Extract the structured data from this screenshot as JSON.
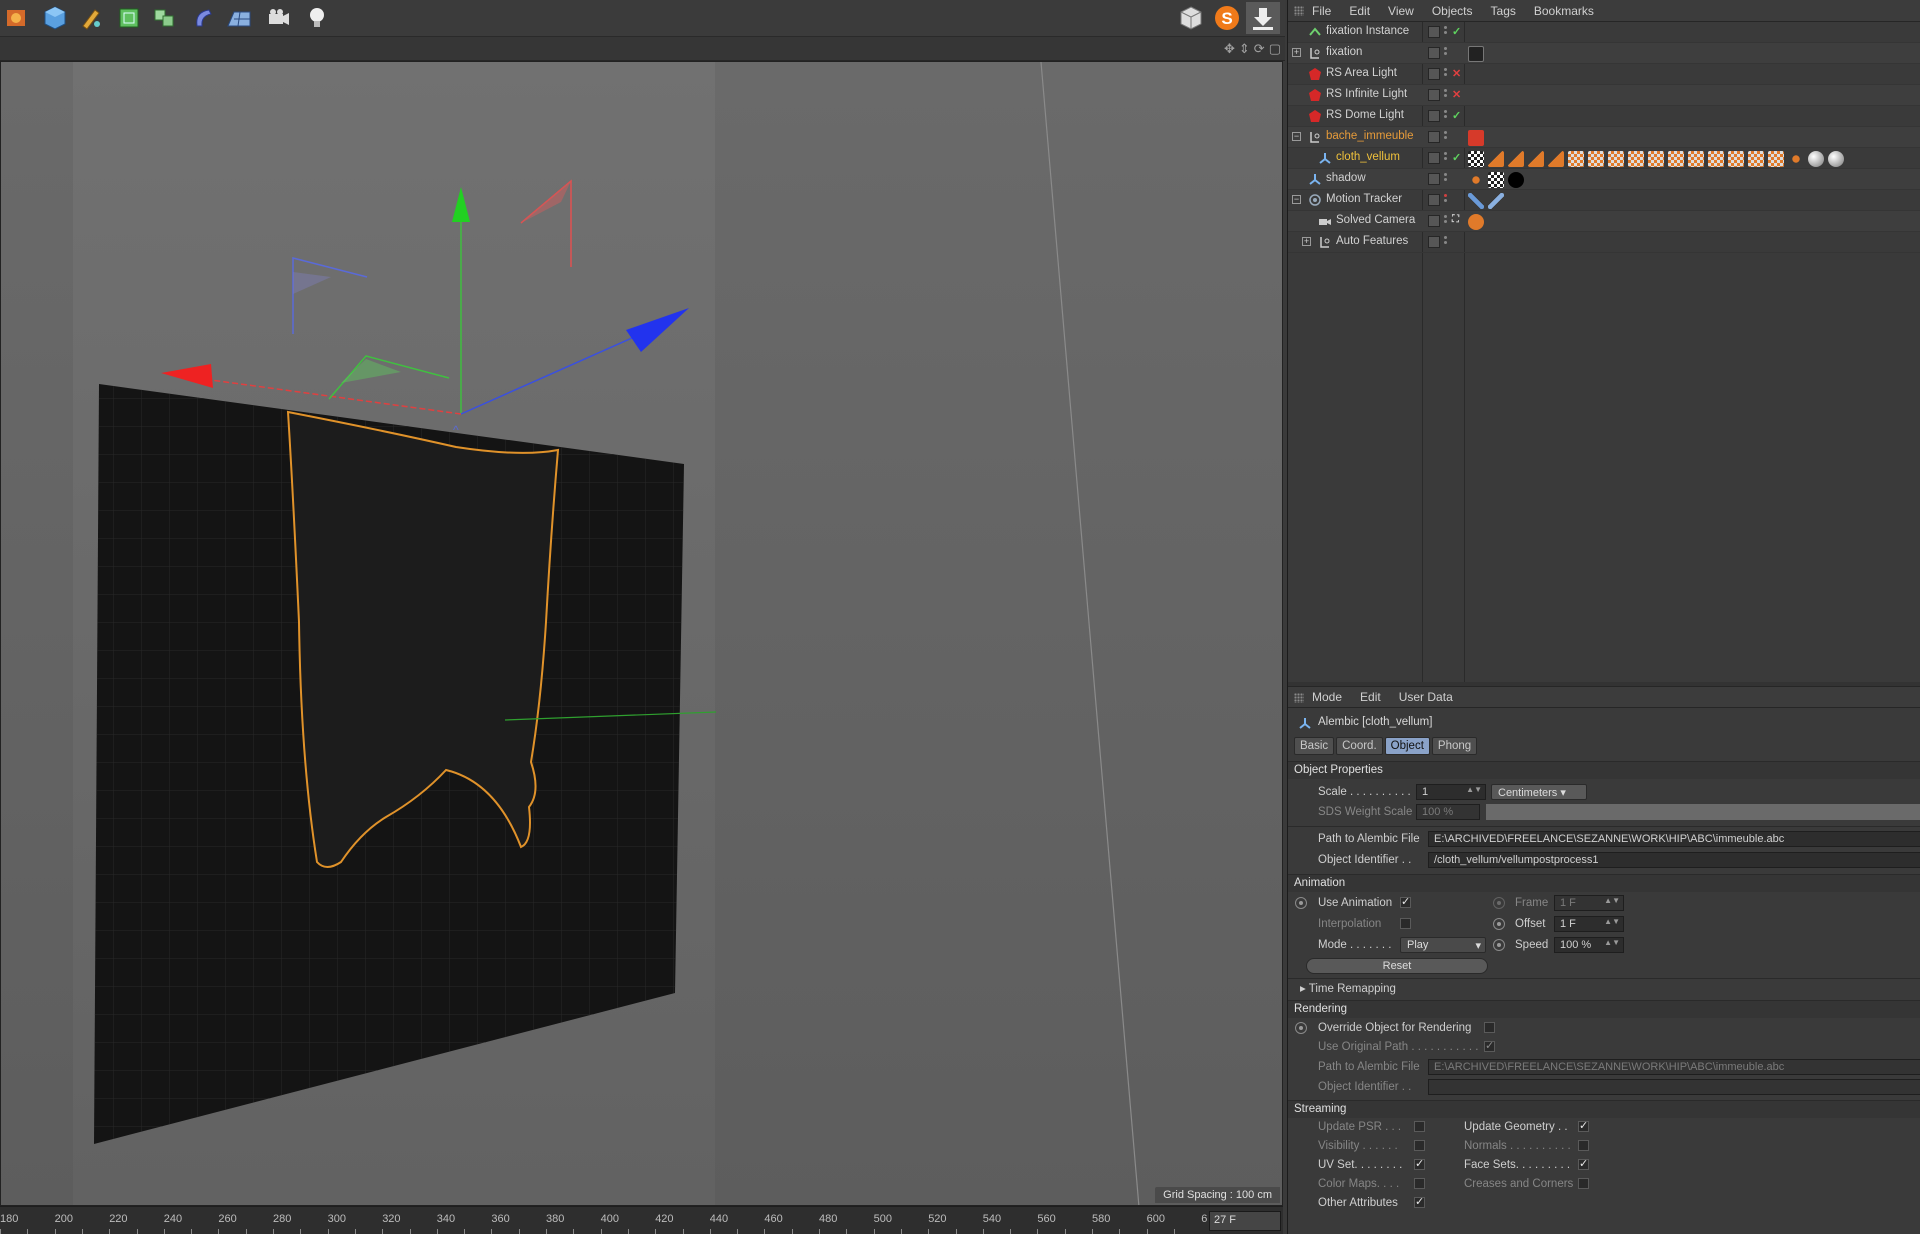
{
  "toolbar": {
    "icons": [
      "render-icon",
      "cube-icon",
      "pen-icon",
      "subdivision-icon",
      "array-icon",
      "deformer-icon",
      "floor-icon",
      "camera-icon",
      "light-icon"
    ],
    "right_icons": [
      "layout-icon",
      "s-plugin-icon",
      "download-icon"
    ]
  },
  "viewport": {
    "grid_spacing": "Grid Spacing : 100 cm"
  },
  "timeline": {
    "ticks": [
      "180",
      "200",
      "220",
      "240",
      "260",
      "280",
      "300",
      "320",
      "340",
      "360",
      "380",
      "400",
      "420",
      "440",
      "460",
      "480",
      "500",
      "520",
      "540",
      "560",
      "580",
      "600",
      "6"
    ],
    "current_frame": "27 F"
  },
  "object_manager": {
    "menu": [
      "File",
      "Edit",
      "View",
      "Objects",
      "Tags",
      "Bookmarks"
    ],
    "rows": [
      {
        "name": "fixation Instance",
        "status": "✓"
      },
      {
        "name": "fixation",
        "status": ""
      },
      {
        "name": "RS Area Light",
        "status": "✕"
      },
      {
        "name": "RS Infinite Light",
        "status": "✕"
      },
      {
        "name": "RS Dome Light",
        "status": "✓"
      },
      {
        "name": "bache_immeuble",
        "status": ""
      },
      {
        "name": "cloth_vellum",
        "status": "✓"
      },
      {
        "name": "shadow",
        "status": ""
      },
      {
        "name": "Motion Tracker",
        "status": ""
      },
      {
        "name": "Solved Camera",
        "status": ""
      },
      {
        "name": "Auto Features",
        "status": ""
      }
    ],
    "colors": {
      "orange": "#e69b3a",
      "selected": "#f0c23c",
      "check": "#5fd35f",
      "cross": "#e04040"
    }
  },
  "attribute_manager": {
    "menu": [
      "Mode",
      "Edit",
      "User Data"
    ],
    "title": "Alembic [cloth_vellum]",
    "tabs": [
      "Basic",
      "Coord.",
      "Object",
      "Phong"
    ],
    "active_tab": "Object",
    "object_properties": {
      "header": "Object Properties",
      "scale_label": "Scale . . . . . . . . . .",
      "scale_value": "1",
      "scale_unit": "Centimeters",
      "sds_label": "SDS Weight Scale",
      "sds_value": "100 %",
      "path_label": "Path to Alembic File",
      "path_value": "E:\\ARCHIVED\\FREELANCE\\SEZANNE\\WORK\\HIP\\ABC\\immeuble.abc",
      "id_label": "Object Identifier . .",
      "id_value": "/cloth_vellum/vellumpostprocess1"
    },
    "animation": {
      "header": "Animation",
      "use_animation": "Use Animation",
      "interpolation": "Interpolation",
      "mode_label": "Mode . . . . . . .",
      "mode_value": "Play",
      "frame_label": "Frame",
      "frame_value": "1 F",
      "offset_label": "Offset",
      "offset_value": "1 F",
      "speed_label": "Speed",
      "speed_value": "100 %",
      "reset": "Reset",
      "time_remapping": "Time Remapping"
    },
    "rendering": {
      "header": "Rendering",
      "override": "Override Object for Rendering",
      "use_original": "Use Original Path . . . . . . . . . . .",
      "path_label": "Path to Alembic File",
      "path_value": "E:\\ARCHIVED\\FREELANCE\\SEZANNE\\WORK\\HIP\\ABC\\immeuble.abc",
      "id_label": "Object Identifier . ."
    },
    "streaming": {
      "header": "Streaming",
      "left": [
        "Update PSR . . .",
        "Visibility . . . . . .",
        "UV Set. . . . . . . .",
        "Color Maps. . . .",
        "Other Attributes"
      ],
      "left_checked": [
        false,
        false,
        true,
        false,
        true
      ],
      "right": [
        "Update Geometry . .",
        "Normals . . . . . . . . . .",
        "Face Sets. . . . . . . . .",
        "Creases and Corners"
      ],
      "right_checked": [
        true,
        false,
        true,
        false
      ]
    }
  }
}
